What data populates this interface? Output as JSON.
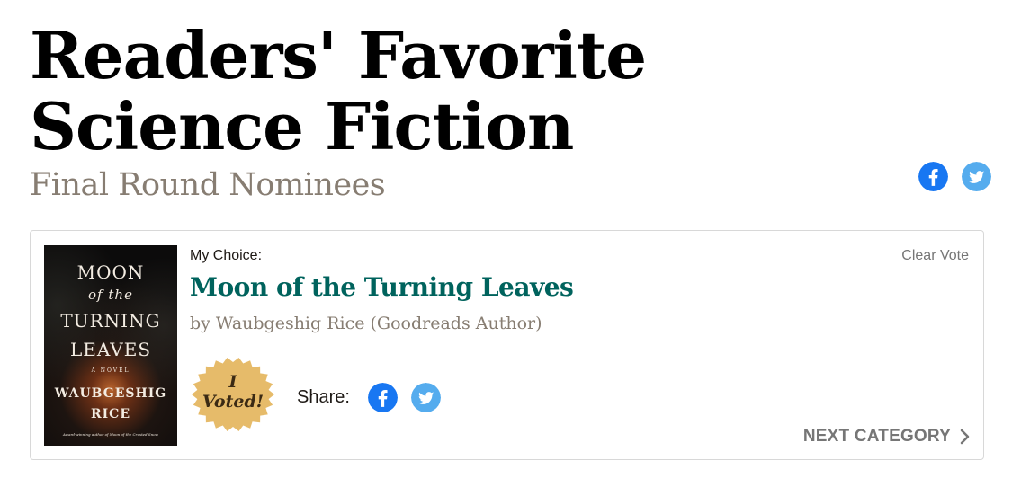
{
  "header": {
    "title": "Readers' Favorite Science Fiction",
    "subtitle": "Final Round Nominees",
    "share_icons": [
      "facebook-icon",
      "twitter-icon"
    ]
  },
  "choice": {
    "label": "My Choice:",
    "clear_vote": "Clear Vote",
    "book": {
      "title": "Moon of the Turning Leaves",
      "author": "by Waubgeshig Rice (Goodreads Author)",
      "cover": {
        "line1": "MOON",
        "line2": "of the",
        "line3": "TURNING",
        "line4": "LEAVES",
        "tag": "A NOVEL",
        "author_line1": "WAUBGESHIG",
        "author_line2": "RICE",
        "blurb": "Award-winning author of Moon of the Crusted Snow"
      }
    },
    "badge": {
      "line1": "I",
      "line2": "Voted!"
    },
    "share_label": "Share:",
    "next_category": "NEXT CATEGORY"
  },
  "colors": {
    "title": "#000000",
    "subtitle": "#877d72",
    "book_title": "#00635d",
    "facebook": "#1877f2",
    "twitter": "#55acee",
    "badge": "#e6bb6a"
  }
}
